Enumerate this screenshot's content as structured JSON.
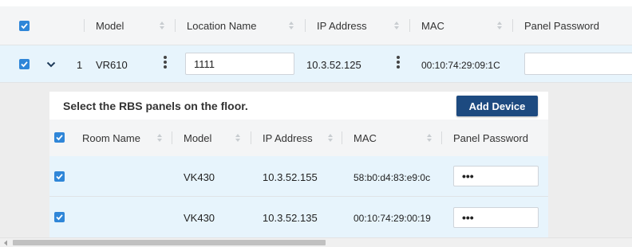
{
  "outer_table": {
    "headers": {
      "model": "Model",
      "location_name": "Location Name",
      "ip_address": "IP Address",
      "mac": "MAC",
      "panel_password": "Panel Password"
    },
    "row": {
      "index": "1",
      "model": "VR610",
      "location_name": "1111",
      "ip_address": "10.3.52.125",
      "mac": "00:10:74:29:09:1C",
      "panel_password": ""
    }
  },
  "detail": {
    "title": "Select the RBS panels on the floor.",
    "add_button": "Add Device",
    "headers": {
      "room_name": "Room Name",
      "model": "Model",
      "ip_address": "IP Address",
      "mac": "MAC",
      "panel_password": "Panel Password"
    },
    "rows": [
      {
        "room_name": "",
        "model": "VK430",
        "ip_address": "10.3.52.155",
        "mac": "58:b0:d4:83:e9:0c",
        "panel_password": "•••"
      },
      {
        "room_name": "",
        "model": "VK430",
        "ip_address": "10.3.52.135",
        "mac": "00:10:74:29:00:19",
        "panel_password": "•••"
      }
    ]
  },
  "icons": [
    "checkbox-checked-icon",
    "chevron-down-icon",
    "sort-icon",
    "kebab-menu-icon",
    "scroll-left-arrow-icon"
  ],
  "colors": {
    "accent": "#2f86d8",
    "button": "#1d4a80",
    "row_highlight": "#e7f4fc",
    "header_bg": "#f4f5f6",
    "panel_bg": "#ededed"
  }
}
